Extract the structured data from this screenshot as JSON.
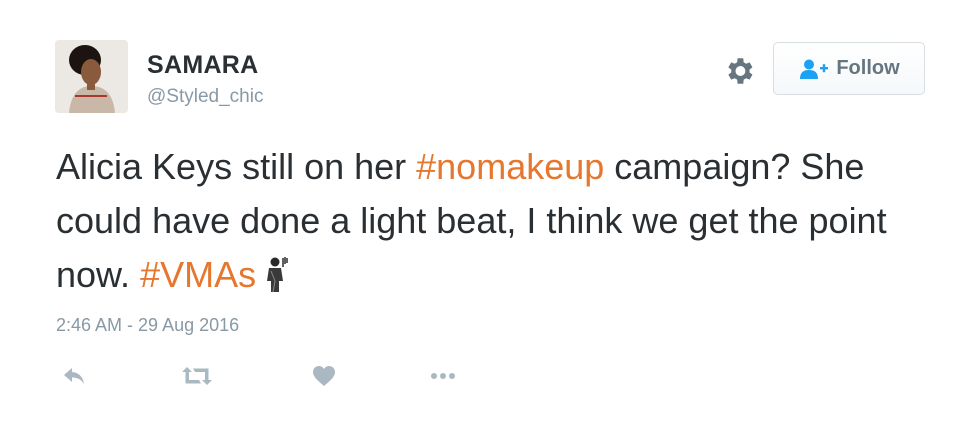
{
  "tweet": {
    "author": {
      "display_name": "SAMARA",
      "handle": "@Styled_chic"
    },
    "follow_label": "Follow",
    "text_segments": [
      {
        "text": "Alicia Keys still on her ",
        "type": "text"
      },
      {
        "text": "#nomakeup",
        "type": "hashtag"
      },
      {
        "text": " campaign? She could have done a light beat, I think we get the point now. ",
        "type": "text"
      },
      {
        "text": "#VMAs",
        "type": "hashtag"
      }
    ],
    "timestamp": "2:46 AM - 29 Aug 2016"
  },
  "icons": {
    "settings": "gear-icon",
    "follow": "add-user-icon",
    "reply": "reply-icon",
    "retweet": "retweet-icon",
    "like": "heart-icon",
    "more": "more-icon",
    "emoji": "person-emoji-icon"
  },
  "colors": {
    "hashtag": "#e5772e",
    "secondary_text": "#8899a6",
    "primary_text": "#292f33",
    "follow_icon": "#1da1f2",
    "action_icon": "#aab8c2"
  }
}
